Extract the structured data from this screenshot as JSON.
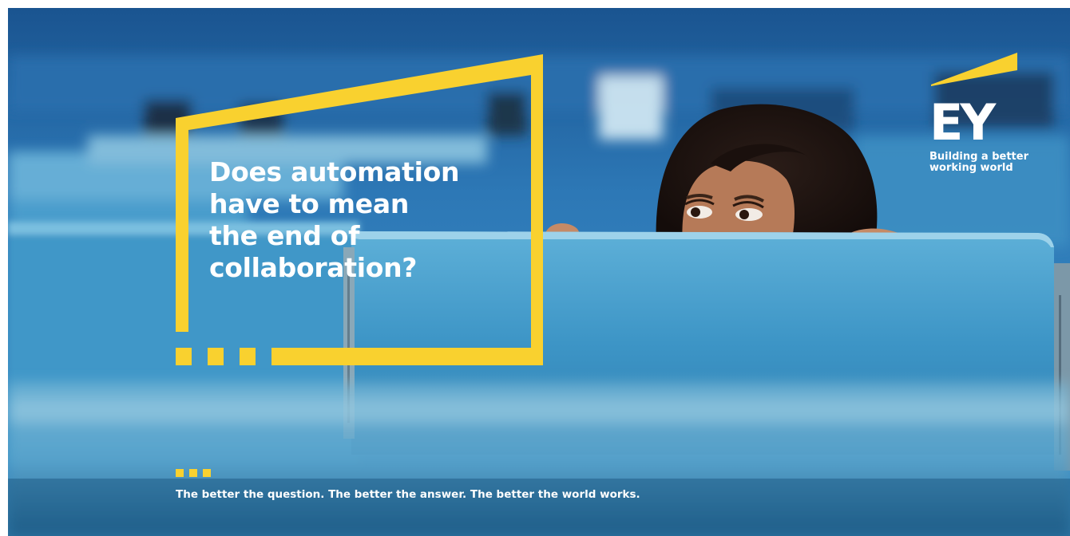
{
  "ad": {
    "headline": "Does automation\nhave to mean\nthe end of\ncollaboration?",
    "slogan": "The better the question. The better the answer. The better the world works."
  },
  "brand": {
    "logo_text": "EY",
    "tagline": "Building a better\nworking world",
    "accent_color": "#f9d12f",
    "text_color": "#ffffff"
  },
  "photo": {
    "description_icon": "woman-peeking-over-cubicle-wall"
  }
}
